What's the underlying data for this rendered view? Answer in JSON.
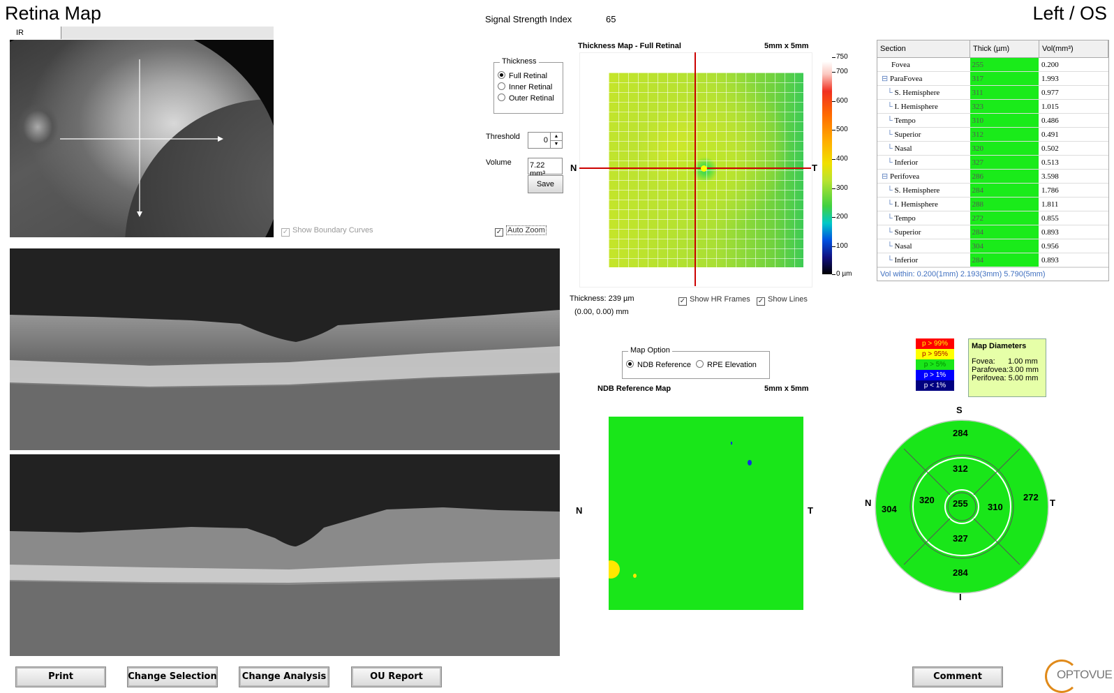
{
  "header": {
    "title": "Retina Map",
    "eye": "Left / OS",
    "ssi_label": "Signal Strength Index",
    "ssi_value": "65"
  },
  "ir": {
    "tab": "IR",
    "show_boundary": "Show Boundary Curves",
    "auto_zoom": "Auto Zoom"
  },
  "thickness": {
    "group": "Thickness",
    "options": [
      "Full Retinal",
      "Inner Retinal",
      "Outer Retinal"
    ],
    "selected": "Full Retinal",
    "threshold_label": "Threshold",
    "threshold_value": "0",
    "volume_label": "Volume",
    "volume_value": "7.22 mm³",
    "save": "Save"
  },
  "tmap": {
    "title": "Thickness Map - Full Retinal",
    "size": "5mm x 5mm",
    "nasal": "N",
    "temporal": "T",
    "thickness_readout": "Thickness: 239 µm",
    "coord_readout": "(0.00, 0.00) mm",
    "show_hr": "Show HR Frames",
    "show_lines": "Show Lines",
    "scale": [
      "750",
      "700",
      "600",
      "500",
      "400",
      "300",
      "200",
      "100",
      "0 µm"
    ]
  },
  "map_option": {
    "group": "Map Option",
    "options": [
      "NDB Reference",
      "RPE Elevation"
    ],
    "selected": "NDB Reference"
  },
  "ndb": {
    "title": "NDB Reference Map",
    "size": "5mm x 5mm",
    "nasal": "N",
    "temporal": "T"
  },
  "table": {
    "headers": [
      "Section",
      "Thick (µm)",
      "Vol(mm³)"
    ],
    "rows": [
      {
        "section": "Fovea",
        "thick": "255",
        "vol": "0.200",
        "level": 0
      },
      {
        "section": "ParaFovea",
        "thick": "317",
        "vol": "1.993",
        "level": 1
      },
      {
        "section": "S. Hemisphere",
        "thick": "311",
        "vol": "0.977",
        "level": 2
      },
      {
        "section": "I. Hemisphere",
        "thick": "323",
        "vol": "1.015",
        "level": 2
      },
      {
        "section": "Tempo",
        "thick": "310",
        "vol": "0.486",
        "level": 2
      },
      {
        "section": "Superior",
        "thick": "312",
        "vol": "0.491",
        "level": 2
      },
      {
        "section": "Nasal",
        "thick": "320",
        "vol": "0.502",
        "level": 2
      },
      {
        "section": "Inferior",
        "thick": "327",
        "vol": "0.513",
        "level": 2
      },
      {
        "section": "Perifovea",
        "thick": "286",
        "vol": "3.598",
        "level": 1
      },
      {
        "section": "S. Hemisphere",
        "thick": "284",
        "vol": "1.786",
        "level": 2
      },
      {
        "section": "I. Hemisphere",
        "thick": "288",
        "vol": "1.811",
        "level": 2
      },
      {
        "section": "Tempo",
        "thick": "272",
        "vol": "0.855",
        "level": 2
      },
      {
        "section": "Superior",
        "thick": "284",
        "vol": "0.893",
        "level": 2
      },
      {
        "section": "Nasal",
        "thick": "304",
        "vol": "0.956",
        "level": 2
      },
      {
        "section": "Inferior",
        "thick": "284",
        "vol": "0.893",
        "level": 2
      }
    ],
    "footer": "Vol within: 0.200(1mm) 2.193(3mm) 5.790(5mm)"
  },
  "plegend": [
    {
      "label": "p > 99%",
      "color": "#ff0000",
      "text": "#ffff00"
    },
    {
      "label": "p > 95%",
      "color": "#ffff00",
      "text": "#aa0000"
    },
    {
      "label": "p > 5%",
      "color": "#19e619",
      "text": "#008800"
    },
    {
      "label": "p > 1%",
      "color": "#0000ff",
      "text": "#ffffff"
    },
    {
      "label": "p < 1%",
      "color": "#000080",
      "text": "#ffffff"
    }
  ],
  "diameters": {
    "title": "Map Diameters",
    "fovea": "Fovea:      1.00 mm",
    "parafovea": "Parafovea:3.00 mm",
    "perifovea": "Perifovea: 5.00 mm"
  },
  "sector": {
    "s": "S",
    "i": "I",
    "n": "N",
    "t": "T",
    "outer_s": "284",
    "outer_i": "284",
    "outer_n": "304",
    "outer_t": "272",
    "inner_s": "312",
    "inner_i": "327",
    "inner_n": "320",
    "inner_t": "310",
    "center": "255"
  },
  "buttons": {
    "print": "Print",
    "change_selection": "Change Selection",
    "change_analysis": "Change Analysis",
    "ou_report": "OU Report",
    "comment": "Comment"
  },
  "logo": "OPTOVUE"
}
